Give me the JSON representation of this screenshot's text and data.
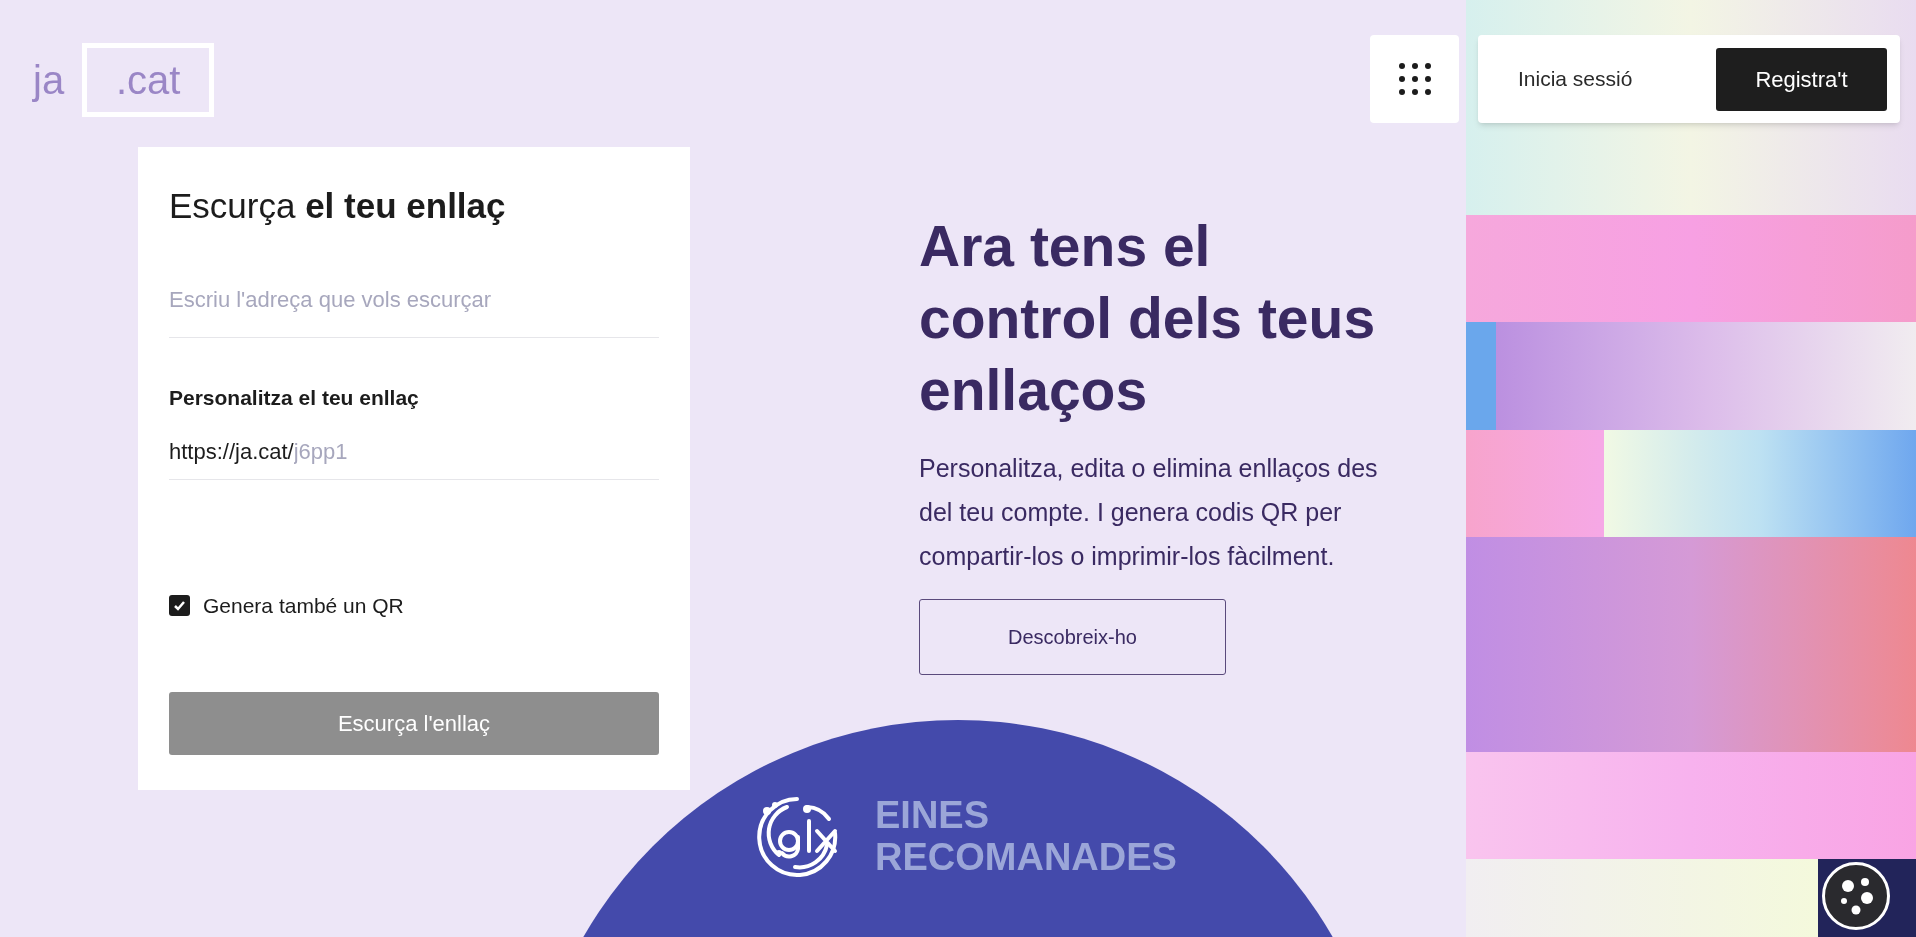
{
  "logo": {
    "prefix": "ja",
    "boxed": ".cat"
  },
  "header": {
    "login": "Inicia sessió",
    "register": "Registra't"
  },
  "shortener": {
    "title": "Escurça **el teu enllaç**",
    "url_field": {
      "placeholder": "Escriu l'adreça que vols escurçar"
    },
    "custom_label": "Personalitza el teu enllaç",
    "custom_field": {
      "prefix": "https://ja.cat/",
      "placeholder": "j6pp1"
    },
    "qr_option": {
      "label": "Genera també un QR",
      "checked": true
    },
    "submit": {
      "label": "Escurça l'enllaç",
      "disabled": true
    }
  },
  "hero": {
    "headline": "Ara tens el control dels teus enllaços",
    "text": "Personalitza, edita o elimina enllaços des del teu compte. I genera codis QR per compartir-los o imprimir-los fàcilment.",
    "button": "Descobreix-ho"
  },
  "promo": {
    "lines": [
      "EINES",
      "RECOMANADES"
    ]
  }
}
